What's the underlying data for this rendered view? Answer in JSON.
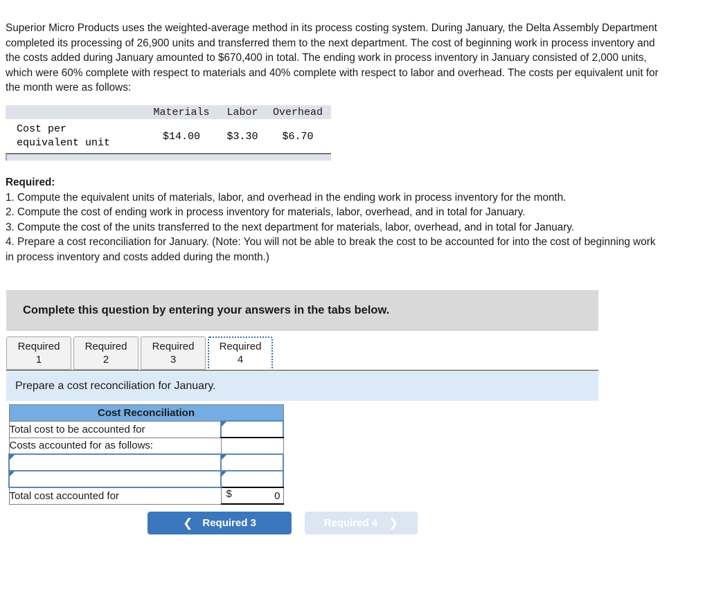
{
  "problem": {
    "paragraph": "Superior Micro Products uses the weighted-average method in its process costing system. During January, the Delta Assembly Department completed its processing of 26,900 units and transferred them to the next department. The cost of beginning work in process inventory and the costs added during January amounted to $670,400 in total. The ending work in process inventory in January consisted of 2,000 units, which were 60% complete with respect to materials and 40% complete with respect to labor and overhead. The costs per equivalent unit for the month were as follows:"
  },
  "cost_table": {
    "headers": {
      "materials": "Materials",
      "labor": "Labor",
      "overhead": "Overhead"
    },
    "row_label": "Cost per\nequivalent unit",
    "values": {
      "materials": "$14.00",
      "labor": "$3.30",
      "overhead": "$6.70"
    }
  },
  "required": {
    "title": "Required:",
    "items": [
      "1. Compute the equivalent units of materials, labor, and overhead in the ending work in process inventory for the month.",
      "2. Compute the cost of ending work in process inventory for materials, labor, overhead, and in total for January.",
      "3. Compute the cost of the units transferred to the next department for materials, labor, overhead, and in total for January.",
      "4. Prepare a cost reconciliation for January. (Note: You will not be able to break the cost to be accounted for into the cost of beginning work in process inventory and costs added during the month.)"
    ]
  },
  "banner": {
    "text": "Complete this question by entering your answers in the tabs below."
  },
  "tabs": [
    {
      "label": "Required\n1",
      "selected": false
    },
    {
      "label": "Required\n2",
      "selected": false
    },
    {
      "label": "Required\n3",
      "selected": false
    },
    {
      "label": "Required\n4",
      "selected": true
    }
  ],
  "sub_instruction": {
    "text": "Prepare a cost reconciliation for January."
  },
  "reconciliation": {
    "header": "Cost Reconciliation",
    "rows": [
      {
        "label": "Total cost to be accounted for",
        "value": ""
      },
      {
        "label": "Costs accounted for as follows:",
        "value": ""
      },
      {
        "label": "",
        "value": ""
      },
      {
        "label": "",
        "value": ""
      }
    ],
    "total_row": {
      "label": "Total cost accounted for",
      "currency": "$",
      "value": "0"
    }
  },
  "navigation": {
    "prev_label": "Required 3",
    "prev_icon": "chevron-left-icon",
    "next_label": "Required 4",
    "next_icon": "chevron-right-icon"
  },
  "colors": {
    "header_blue": "#74ade3",
    "banner_gray": "#d9d9d9",
    "subinstruction_blue": "#dceaf7",
    "primary_button": "#3b77bc",
    "disabled_button": "#dce6f2",
    "input_border": "#5b87b4"
  }
}
